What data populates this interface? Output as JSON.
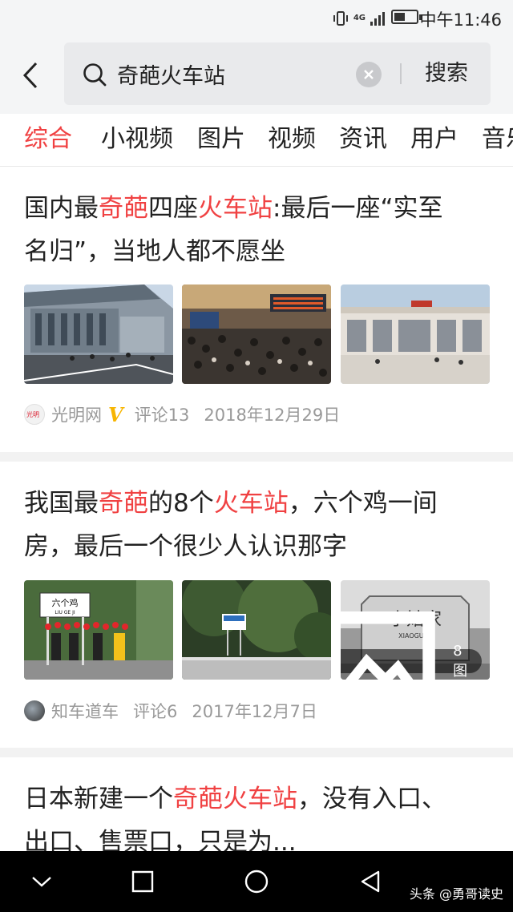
{
  "status_bar": {
    "network": "4G",
    "time": "中午11:46",
    "battery_level": 0.5
  },
  "search": {
    "query": "奇葩火车站",
    "submit_label": "搜索"
  },
  "tabs": [
    {
      "label": "综合",
      "active": true
    },
    {
      "label": "小视频",
      "active": false
    },
    {
      "label": "图片",
      "active": false
    },
    {
      "label": "视频",
      "active": false
    },
    {
      "label": "资讯",
      "active": false
    },
    {
      "label": "用户",
      "active": false
    },
    {
      "label": "音乐",
      "active": false
    }
  ],
  "articles": [
    {
      "title_lines": [
        [
          {
            "t": "国内最"
          },
          {
            "t": "奇葩",
            "hl": true
          },
          {
            "t": "四座"
          },
          {
            "t": "火车站",
            "hl": true
          },
          {
            "t": ":最后一座“实至"
          }
        ],
        [
          {
            "t": "名归”，当地人都不愿坐"
          }
        ]
      ],
      "source": "光明网",
      "verified": "V",
      "comments": "评论13",
      "date": "2018年12月29日"
    },
    {
      "title_lines": [
        [
          {
            "t": "我国最"
          },
          {
            "t": "奇葩",
            "hl": true
          },
          {
            "t": "的8个"
          },
          {
            "t": "火车站",
            "hl": true
          },
          {
            "t": "，六个鸡一间"
          }
        ],
        [
          {
            "t": "房，最后一个很少人认识那字"
          }
        ]
      ],
      "source": "知车道车",
      "comments": "评论6",
      "date": "2017年12月7日",
      "image_count": "8图",
      "image_texts": {
        "sign1": "六个鸡",
        "sign1_pinyin": "LIU GE JI",
        "sign3": "小姑家",
        "sign3_pinyin": "XIAOGUJIA"
      }
    },
    {
      "title_lines": [
        [
          {
            "t": "日本新建一个"
          },
          {
            "t": "奇葩火车站",
            "hl": true
          },
          {
            "t": "，没有入口、"
          }
        ],
        [
          {
            "t": "出口、售票口，只是为..."
          }
        ]
      ]
    }
  ],
  "watermark": "头条 @勇哥读史",
  "colors": {
    "accent": "#f04142",
    "meta": "#999999",
    "header_bg": "#f4f5f6",
    "verified": "#f7b500"
  }
}
